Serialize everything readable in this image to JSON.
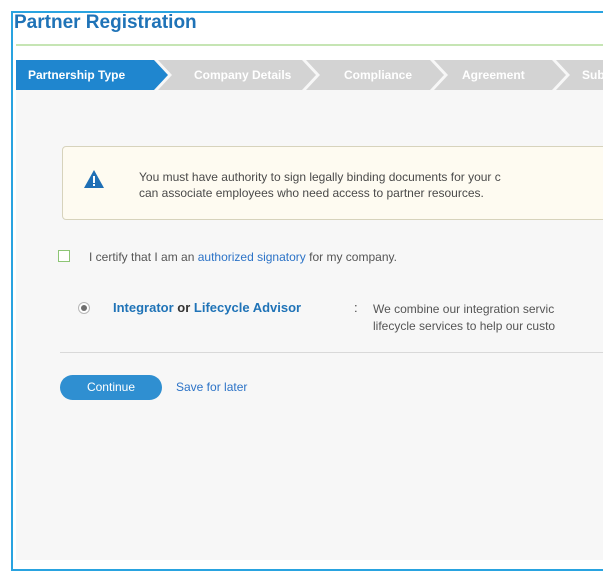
{
  "page": {
    "title": "Partner Registration"
  },
  "steps": [
    {
      "label": "Partnership Type",
      "active": true
    },
    {
      "label": "Company Details",
      "active": false
    },
    {
      "label": "Compliance",
      "active": false
    },
    {
      "label": "Agreement",
      "active": false
    },
    {
      "label": "Subm",
      "active": false
    }
  ],
  "alert": {
    "icon": "warning-icon",
    "line1": "You must have authority to sign legally binding documents for your c",
    "line2": "can associate employees who need access to partner resources."
  },
  "certify": {
    "text_before": "I certify that I am an",
    "link_text": "authorized signatory",
    "text_after": "for my company."
  },
  "option": {
    "name_a": "Integrator",
    "connector": "or",
    "name_b": "Lifecycle Advisor",
    "colon": ":",
    "desc_line1": "We combine our integration servic",
    "desc_line2": "lifecycle services to help our custo"
  },
  "actions": {
    "continue_label": "Continue",
    "save_label": "Save for later"
  },
  "colors": {
    "accent": "#1f73b7",
    "active_step": "#1f86cf",
    "inactive_step": "#d3d3d3",
    "frame_border": "#29a3e0"
  }
}
